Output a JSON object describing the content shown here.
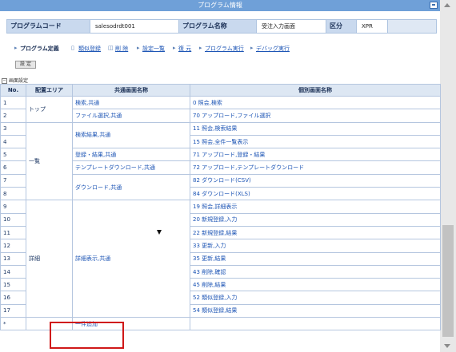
{
  "window": {
    "title": "プログラム情報"
  },
  "info": [
    {
      "label": "プログラムコード",
      "value": "salesodrdt001"
    },
    {
      "label": "プログラム名称",
      "value": "受注入力画面"
    },
    {
      "label": "区分",
      "value": "XPR"
    }
  ],
  "menu": {
    "current": "プログラム定義",
    "items": [
      "類似登録",
      "削 除",
      "設定一覧",
      "復 元",
      "プログラム実行",
      "デバッグ実行"
    ]
  },
  "setting_button": "設 定",
  "section_label": "画面設定",
  "table": {
    "headers": [
      "No.",
      "配置エリア",
      "共通画面名称",
      "個別画面名称"
    ],
    "rows": [
      {
        "no": "1",
        "area": "トップ",
        "common": "検索,共通",
        "individual": "0 照会,検索"
      },
      {
        "no": "2",
        "area": "",
        "common": "ファイル選択,共通",
        "individual": "70 アップロード,ファイル選択"
      },
      {
        "no": "3",
        "area": "一覧",
        "common": "検索結果,共通",
        "individual": "11 照会,検索結果"
      },
      {
        "no": "4",
        "area": "",
        "common": "",
        "individual": "15 照会,全件一覧表示"
      },
      {
        "no": "5",
        "area": "",
        "common": "登録・結果,共通",
        "individual": "71 アップロード,登録・結果"
      },
      {
        "no": "6",
        "area": "",
        "common": "テンプレートダウンロード,共通",
        "individual": "72 アップロード,テンプレートダウンロード"
      },
      {
        "no": "7",
        "area": "",
        "common": "ダウンロード,共通",
        "individual": "82 ダウンロード(CSV)"
      },
      {
        "no": "8",
        "area": "",
        "common": "",
        "individual": "84 ダウンロード(XLS)"
      },
      {
        "no": "9",
        "area": "詳細",
        "common": "詳細表示,共通",
        "individual": "19 照会,詳細表示"
      },
      {
        "no": "10",
        "area": "",
        "common": "",
        "individual": "20 新規登録,入力"
      },
      {
        "no": "11",
        "area": "",
        "common": "",
        "individual": "22 新規登録,結果"
      },
      {
        "no": "12",
        "area": "",
        "common": "",
        "individual": "33 更新,入力"
      },
      {
        "no": "13",
        "area": "",
        "common": "",
        "individual": "35 更新,結果"
      },
      {
        "no": "14",
        "area": "",
        "common": "",
        "individual": "43 削除,確認"
      },
      {
        "no": "15",
        "area": "",
        "common": "",
        "individual": "45 削除,結果"
      },
      {
        "no": "16",
        "area": "",
        "common": "",
        "individual": "52 類似登録,入力"
      },
      {
        "no": "17",
        "area": "",
        "common": "",
        "individual": "54 類似登録,結果"
      }
    ],
    "new_row": {
      "no": "*",
      "add_label": "一件追加"
    }
  }
}
